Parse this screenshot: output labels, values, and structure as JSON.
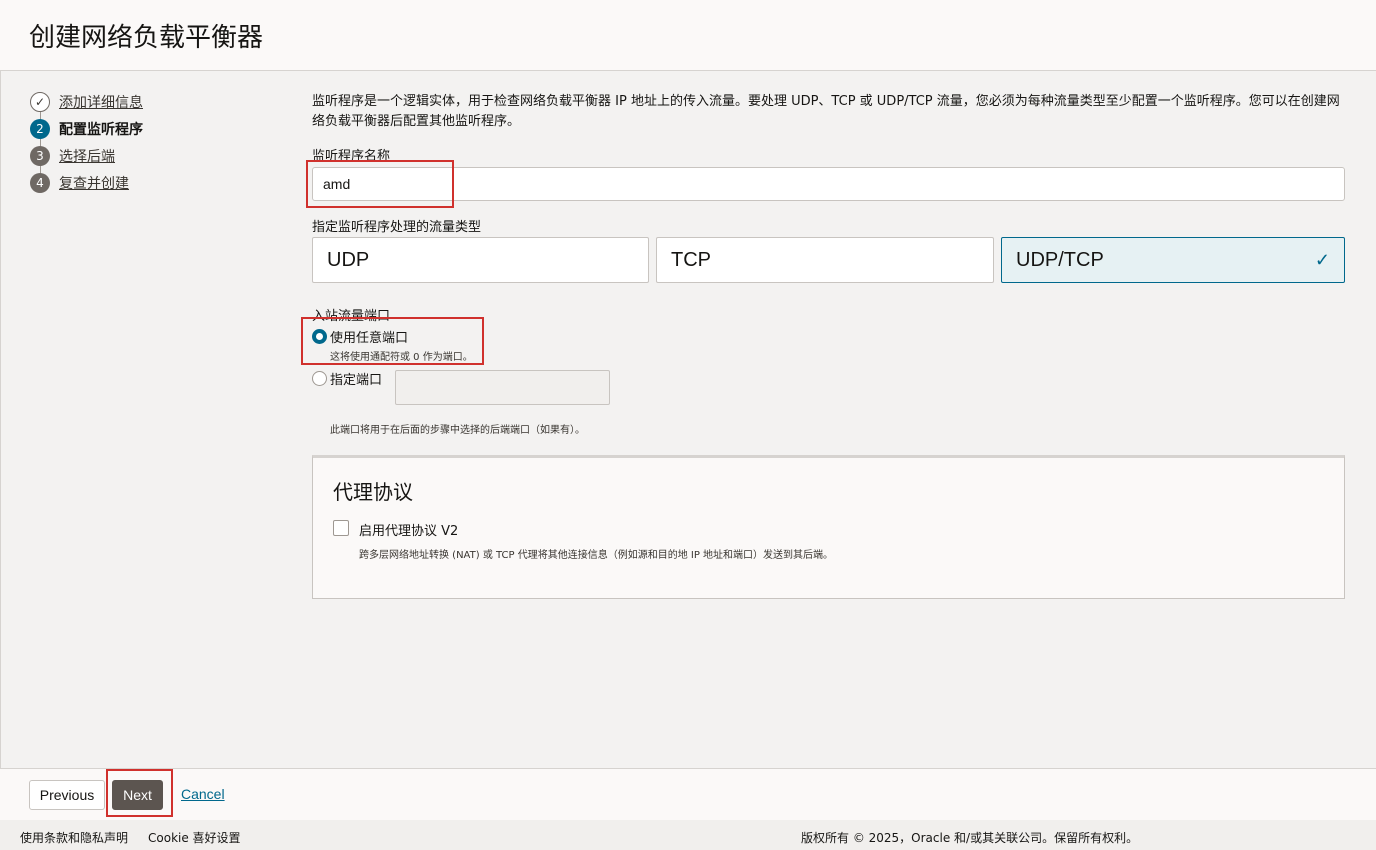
{
  "page": {
    "title": "创建网络负载平衡器"
  },
  "steps": [
    {
      "number": "✓",
      "label": "添加详细信息",
      "state": "done"
    },
    {
      "number": "2",
      "label": "配置监听程序",
      "state": "current"
    },
    {
      "number": "3",
      "label": "选择后端",
      "state": "todo"
    },
    {
      "number": "4",
      "label": "复查并创建",
      "state": "todo"
    }
  ],
  "intro": "监听程序是一个逻辑实体，用于检查网络负载平衡器 IP 地址上的传入流量。要处理 UDP、TCP 或 UDP/TCP 流量，您必须为每种流量类型至少配置一个监听程序。您可以在创建网络负载平衡器后配置其他监听程序。",
  "listener_name": {
    "label": "监听程序名称",
    "value": "amd"
  },
  "traffic_type": {
    "label": "指定监听程序处理的流量类型",
    "options": [
      "UDP",
      "TCP",
      "UDP/TCP"
    ],
    "selected": "UDP/TCP",
    "check_icon": "✓"
  },
  "ingress_port": {
    "label": "入站流量端口",
    "any_port_label": "使用任意端口",
    "any_port_hint": "这将使用通配符或 0 作为端口。",
    "specific_port_label": "指定端口",
    "specific_port_value": "",
    "specific_port_hint": "此端口将用于在后面的步骤中选择的后端端口（如果有）。",
    "selected": "any"
  },
  "proxy": {
    "title": "代理协议",
    "checkbox_label": "启用代理协议 V2",
    "checked": false,
    "hint": "跨多层网络地址转换 (NAT) 或 TCP 代理将其他连接信息（例如源和目的地 IP 地址和端口）发送到其后端。"
  },
  "buttons": {
    "previous": "Previous",
    "next": "Next",
    "cancel": "Cancel"
  },
  "legal": {
    "terms": "使用条款和隐私声明",
    "cookie": "Cookie 喜好设置",
    "copyright": "版权所有 © 2025，Oracle 和/或其关联公司。保留所有权利。"
  },
  "colors": {
    "accent": "#00688c",
    "highlight": "#d0312d",
    "next_button": "#5c5550"
  }
}
